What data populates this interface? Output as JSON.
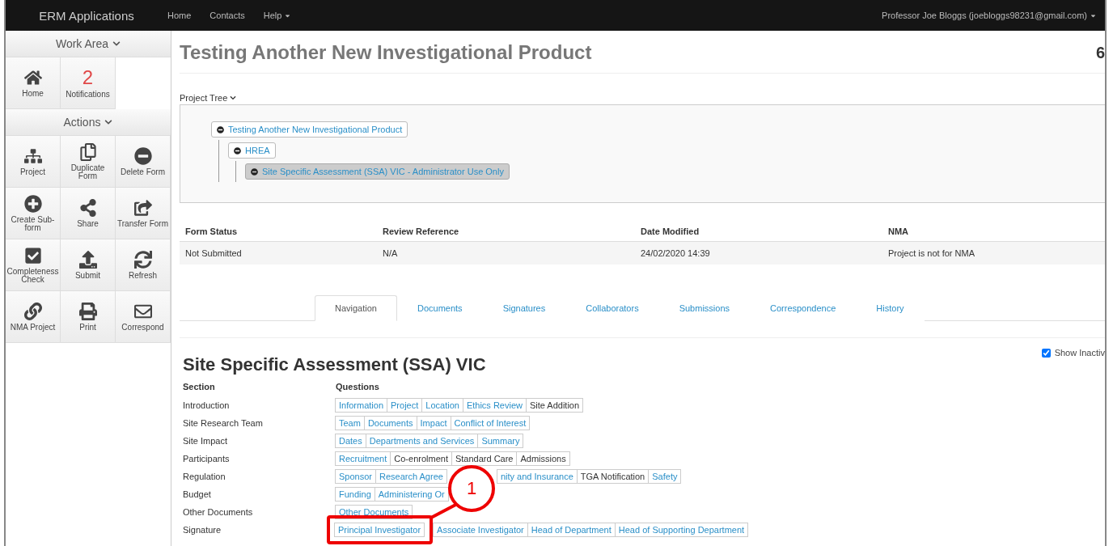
{
  "navbar": {
    "brand": "ERM Applications",
    "links": [
      {
        "label": "Home",
        "dropdown": false
      },
      {
        "label": "Contacts",
        "dropdown": false
      },
      {
        "label": "Help",
        "dropdown": true
      }
    ],
    "user": "Professor Joe Bloggs (joebloggs98231@gmail.com)"
  },
  "sidebar": {
    "sections": [
      {
        "title": "Work Area",
        "items": [
          {
            "label": "Home"
          },
          {
            "count": "2",
            "label": "Notifications"
          }
        ]
      },
      {
        "title": "Actions",
        "items": [
          {
            "label": "Project"
          },
          {
            "label": "Duplicate Form"
          },
          {
            "label": "Delete Form"
          },
          {
            "label": "Create Sub-form"
          },
          {
            "label": "Share"
          },
          {
            "label": "Transfer Form"
          },
          {
            "label": "Completeness Check"
          },
          {
            "label": "Submit"
          },
          {
            "label": "Refresh"
          },
          {
            "label": "NMA Project"
          },
          {
            "label": "Print"
          },
          {
            "label": "Correspond"
          }
        ]
      }
    ]
  },
  "page": {
    "title": "Testing Another New Investigational Product",
    "corner": "6"
  },
  "project_tree": {
    "label": "Project Tree",
    "nodes": [
      {
        "label": "Testing Another New Investigational Product",
        "selected": false,
        "children": [
          {
            "label": "HREA",
            "selected": false,
            "children": [
              {
                "label": "Site Specific Assessment (SSA) VIC - Administrator Use Only",
                "selected": true
              }
            ]
          }
        ]
      }
    ]
  },
  "info_table": {
    "columns": [
      "Form Status",
      "Review Reference",
      "Date Modified",
      "NMA"
    ],
    "rows": [
      [
        "Not Submitted",
        "N/A",
        "24/02/2020 14:39",
        "Project is not for NMA"
      ]
    ]
  },
  "tabs": [
    {
      "label": "Navigation",
      "selected": true
    },
    {
      "label": "Documents",
      "selected": false
    },
    {
      "label": "Signatures",
      "selected": false
    },
    {
      "label": "Collaborators",
      "selected": false
    },
    {
      "label": "Submissions",
      "selected": false
    },
    {
      "label": "Correspondence",
      "selected": false
    },
    {
      "label": "History",
      "selected": false
    }
  ],
  "form": {
    "title": "Site Specific Assessment (SSA) VIC",
    "show_inactive": {
      "label": "Show Inactiv",
      "checked": true
    },
    "columns": [
      "Section",
      "Questions"
    ],
    "sections": [
      {
        "name": "Introduction",
        "questions": [
          {
            "label": "Information",
            "linked": true
          },
          {
            "label": "Project",
            "linked": true
          },
          {
            "label": "Location",
            "linked": true
          },
          {
            "label": "Ethics Review",
            "linked": true
          },
          {
            "label": "Site Addition",
            "linked": false
          }
        ]
      },
      {
        "name": "Site Research Team",
        "questions": [
          {
            "label": "Team",
            "linked": true
          },
          {
            "label": "Documents",
            "linked": true
          },
          {
            "label": "Impact",
            "linked": true
          },
          {
            "label": "Conflict of Interest",
            "linked": true
          }
        ]
      },
      {
        "name": "Site Impact",
        "questions": [
          {
            "label": "Dates",
            "linked": true
          },
          {
            "label": "Departments and Services",
            "linked": true
          },
          {
            "label": "Summary",
            "linked": true
          }
        ]
      },
      {
        "name": "Participants",
        "questions": [
          {
            "label": "Recruitment",
            "linked": true
          },
          {
            "label": "Co-enrolment",
            "linked": false
          },
          {
            "label": "Standard Care",
            "linked": false
          },
          {
            "label": "Admissions",
            "linked": false
          }
        ]
      },
      {
        "name": "Regulation",
        "questions": [
          {
            "label": "Sponsor",
            "linked": true
          },
          {
            "label": "Research Agree",
            "linked": true,
            "obscured": true
          },
          {
            "label": "nity and Insurance",
            "linked": true
          },
          {
            "label": "TGA Notification",
            "linked": false
          },
          {
            "label": "Safety",
            "linked": true
          }
        ]
      },
      {
        "name": "Budget",
        "questions": [
          {
            "label": "Funding",
            "linked": true
          },
          {
            "label": "Administering Or",
            "linked": true,
            "obscured": true
          }
        ]
      },
      {
        "name": "Other Documents",
        "questions": [
          {
            "label": "Other Documents",
            "linked": true
          }
        ]
      },
      {
        "name": "Signature",
        "questions": [
          {
            "label": "Principal Investigator",
            "linked": true,
            "callout": "1"
          },
          {
            "label": "Associate Investigator",
            "linked": true
          },
          {
            "label": "Head of Department",
            "linked": true
          },
          {
            "label": "Head of Supporting Department",
            "linked": true
          }
        ]
      }
    ]
  }
}
